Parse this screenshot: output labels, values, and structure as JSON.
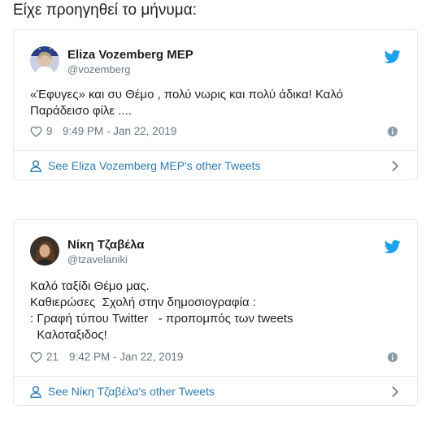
{
  "intro_text": "Είχε προηγηθεί το μήνυμα:",
  "accent": "#1da1f2",
  "link_color": "#2b7bb9",
  "tweets": [
    {
      "name": "Eliza Vozemberg MEP",
      "handle": "@vozemberg",
      "lines": [
        "«Έφυγες» και συ Θέμο , πολύ νωρις και πολύ άδικα! Καλό",
        "Παράδεισο φίλε ...."
      ],
      "likes": "9",
      "time": "9:49 PM - Jan 22, 2019",
      "footer_label": "See Eliza Vozemberg MEP's other Tweets",
      "icons": [
        "avatar",
        "twitter-bird-icon",
        "heart-icon",
        "info-icon",
        "person-icon",
        "chevron-right-icon"
      ]
    },
    {
      "name": "Νίκη Τζαβέλα",
      "handle": "@tzavelaniki",
      "lines": [
        "Καλό ταξίδι Θέμο μας.",
        "Καθιερώσες  Σχολή στην δημοσιογραφία :",
        ": Γραφή τύπου Twitter   - προπομπός των tweets",
        "  Καλοταξιδος!"
      ],
      "likes": "21",
      "time": "9:42 PM - Jan 22, 2019",
      "footer_label": "See Νίκη Τζαβέλα's other Tweets",
      "icons": [
        "avatar",
        "twitter-bird-icon",
        "heart-icon",
        "info-icon",
        "person-icon",
        "chevron-right-icon"
      ]
    }
  ]
}
